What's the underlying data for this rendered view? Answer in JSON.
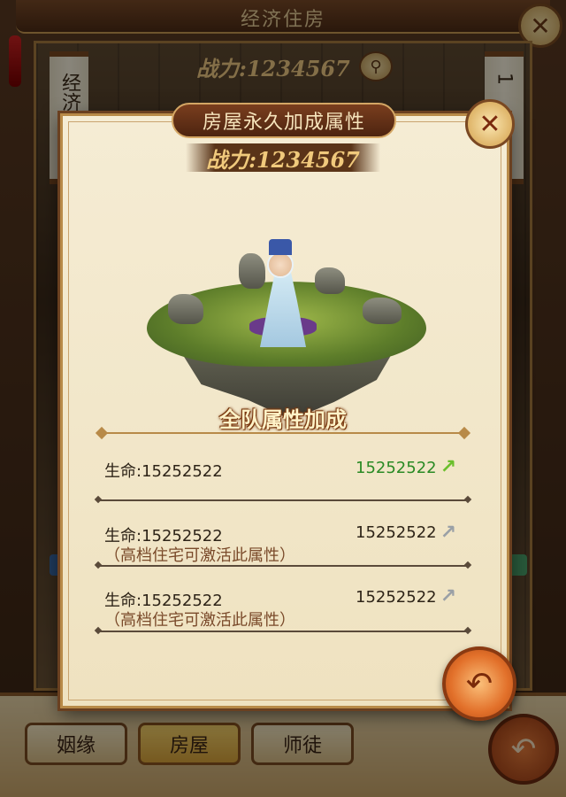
{
  "background": {
    "title": "经济住房",
    "power_text": "战力:1234567",
    "scroll_left": "经济",
    "scroll_right": "1",
    "tabs": [
      {
        "label": "姻缘",
        "active": false
      },
      {
        "label": "房屋",
        "active": true
      },
      {
        "label": "师徒",
        "active": false
      }
    ]
  },
  "dialog": {
    "title": "房屋永久加成属性",
    "power_text": "战力:1234567",
    "team_bonus_title": "全队属性加成",
    "rows": [
      {
        "label": "生命:15252522",
        "value": "15252522",
        "note": "",
        "active": true,
        "arrow_icon": "up-arrow-icon"
      },
      {
        "label": "生命:15252522",
        "value": "15252522",
        "note": "（高档住宅可激活此属性）",
        "active": false,
        "arrow_icon": "up-arrow-icon"
      },
      {
        "label": "生命:15252522",
        "value": "15252522",
        "note": "（高档住宅可激活此属性）",
        "active": false,
        "arrow_icon": "up-arrow-icon"
      }
    ]
  },
  "colors": {
    "active_value": "#2a8a24",
    "active_arrow": "#6bbf2c",
    "inactive_arrow": "#9aa0a6",
    "note": "#7a4a2a"
  }
}
